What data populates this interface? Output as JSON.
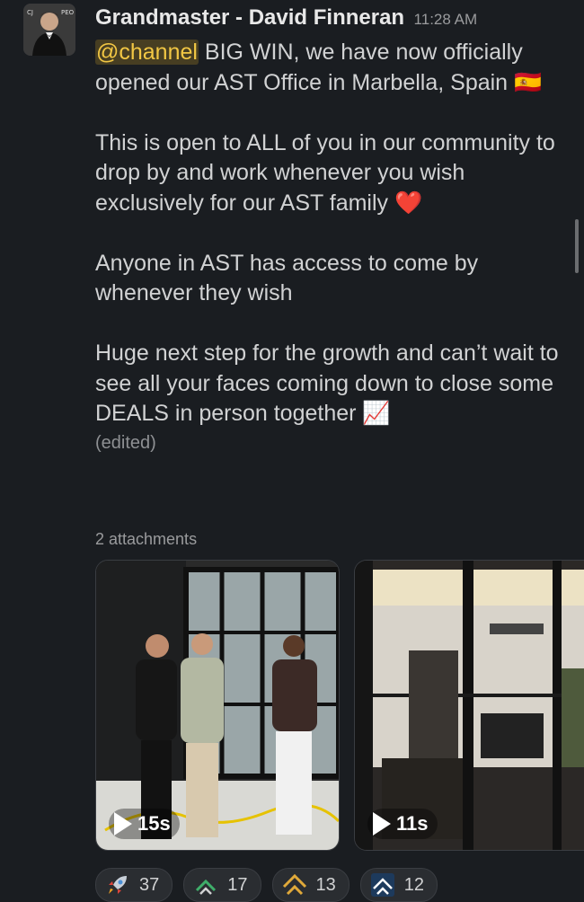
{
  "message": {
    "author": "Grandmaster - David Finneran",
    "time": "11:28 AM",
    "mention": "@channel",
    "line1_rest": " BIG WIN, we have now officially opened our AST Office in Marbella, Spain",
    "flag_emoji": "🇪🇸",
    "para2": "This is open to ALL of you in our community to drop by and work whenever you wish exclusively for our AST family",
    "heart_emoji": "❤️",
    "para3": "Anyone in AST has access to come by whenever they wish",
    "para4": "Huge next step for the growth and can’t wait to see all your faces coming down to close some DEALS in person together",
    "chart_emoji": "📈",
    "edited": "(edited)"
  },
  "attachments": {
    "label": "2 attachments",
    "items": [
      {
        "duration": "15s"
      },
      {
        "duration": "11s"
      }
    ]
  },
  "reactions": [
    {
      "icon": "rocket-icon",
      "count": "37"
    },
    {
      "icon": "ast-logo-green-icon",
      "count": "17"
    },
    {
      "icon": "ast-logo-gold-icon",
      "count": "13"
    },
    {
      "icon": "ast-logo-blue-icon",
      "count": "12"
    }
  ]
}
